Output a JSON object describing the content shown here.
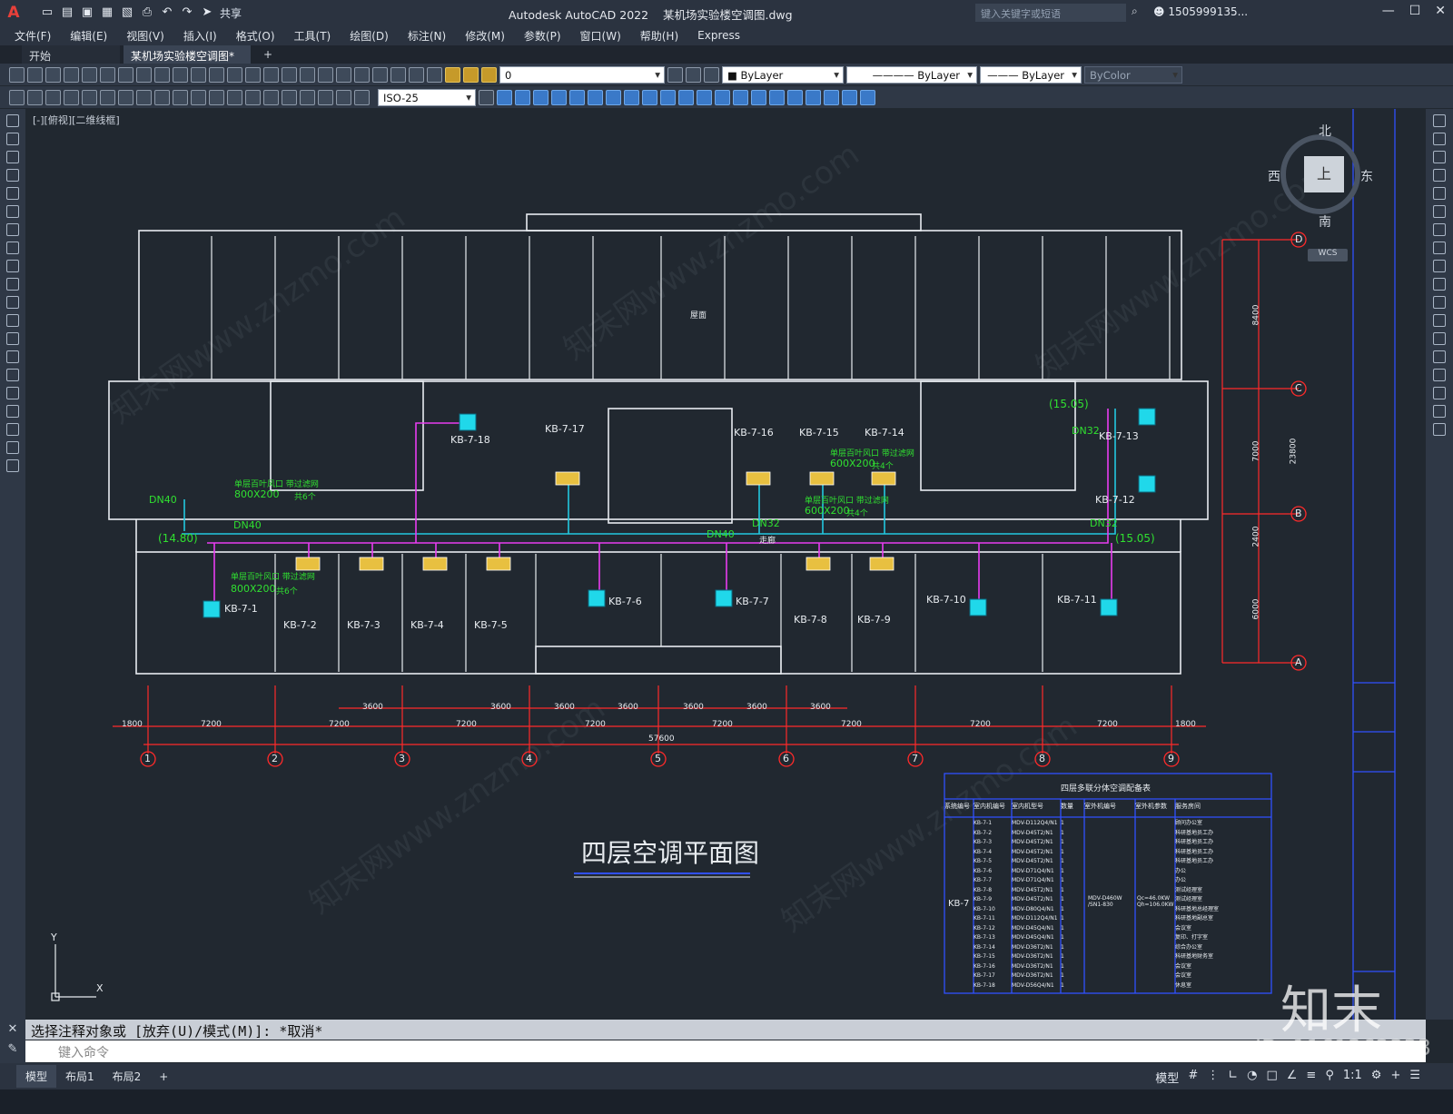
{
  "app": {
    "title": "Autodesk AutoCAD 2022",
    "document": "某机场实验楼空调图.dwg",
    "share": "共享",
    "search_placeholder": "键入关键字或短语",
    "user": "1505999135..."
  },
  "menu": [
    "文件(F)",
    "编辑(E)",
    "视图(V)",
    "插入(I)",
    "格式(O)",
    "工具(T)",
    "绘图(D)",
    "标注(N)",
    "修改(M)",
    "参数(P)",
    "窗口(W)",
    "帮助(H)",
    "Express"
  ],
  "tabs": [
    "开始",
    "某机场实验楼空调图*"
  ],
  "toolbar": {
    "layer": "0",
    "color": "ByLayer",
    "linetype": "ByLayer",
    "lineweight": "ByLayer",
    "plotstyle": "ByColor",
    "dimstyle": "ISO-25"
  },
  "view_label": "[-][俯视][二维线框]",
  "viewcube": {
    "north": "北",
    "south": "南",
    "east": "东",
    "west": "西",
    "top": "上",
    "wcs": "WCS"
  },
  "drawing": {
    "title": "四层空调平面图",
    "roof": "屋面",
    "grid_numbers": [
      "1",
      "2",
      "3",
      "4",
      "5",
      "6",
      "7",
      "8",
      "9"
    ],
    "grid_letters": [
      "D",
      "C",
      "B",
      "A"
    ],
    "dims_bottom": [
      "1800",
      "7200",
      "7200",
      "7200",
      "7200",
      "7200",
      "7200",
      "7200",
      "7200",
      "1800"
    ],
    "dims_sub": [
      "3600",
      "3600",
      "3600",
      "3600",
      "3600",
      "3600",
      "3600"
    ],
    "total": "57600",
    "dims_right": [
      "8400",
      "7000",
      "2400",
      "6000",
      "23800"
    ],
    "units_top": [
      "KB-7-18",
      "KB-7-17",
      "KB-7-16",
      "KB-7-15",
      "KB-7-14",
      "KB-7-13",
      "KB-7-12"
    ],
    "units_bottom": [
      "KB-7-1",
      "KB-7-2",
      "KB-7-3",
      "KB-7-4",
      "KB-7-5",
      "KB-7-6",
      "KB-7-7",
      "KB-7-8",
      "KB-7-9",
      "KB-7-10",
      "KB-7-11"
    ],
    "pipes": [
      "DN40",
      "DN40",
      "DN40",
      "DN32",
      "DN32",
      "DN32"
    ],
    "levels": [
      "(14.80)",
      "(15.05)",
      "(15.05)"
    ],
    "vents": [
      "单层百叶风口 带过滤网",
      "800X200",
      "共6个",
      "600X200",
      "共4个"
    ],
    "corridor": "走廊"
  },
  "table": {
    "title": "四层多联分体空调配备表",
    "headers": [
      "系统编号",
      "室内机编号",
      "室内机型号",
      "数量",
      "室外机编号",
      "室外机参数",
      "服务房间"
    ],
    "system": "KB-7",
    "outdoor_model": "MDV-D460W /SN1-830",
    "outdoor_params": "Qc=46.0KW Qh=106.0KW",
    "rows": [
      {
        "no": "KB-7-1",
        "model": "MDV-D112Q4/N1",
        "qty": "1",
        "room": "顾问办公室"
      },
      {
        "no": "KB-7-2",
        "model": "MDV-D45T2/N1",
        "qty": "1",
        "room": "科研基地员工办"
      },
      {
        "no": "KB-7-3",
        "model": "MDV-D45T2/N1",
        "qty": "1",
        "room": "科研基地员工办"
      },
      {
        "no": "KB-7-4",
        "model": "MDV-D45T2/N1",
        "qty": "1",
        "room": "科研基地员工办"
      },
      {
        "no": "KB-7-5",
        "model": "MDV-D45T2/N1",
        "qty": "1",
        "room": "科研基地员工办"
      },
      {
        "no": "KB-7-6",
        "model": "MDV-D71Q4/N1",
        "qty": "1",
        "room": "办公"
      },
      {
        "no": "KB-7-7",
        "model": "MDV-D71Q4/N1",
        "qty": "1",
        "room": "办公"
      },
      {
        "no": "KB-7-8",
        "model": "MDV-D45T2/N1",
        "qty": "1",
        "room": "测试经理室"
      },
      {
        "no": "KB-7-9",
        "model": "MDV-D45T2/N1",
        "qty": "1",
        "room": "测试经理室"
      },
      {
        "no": "KB-7-10",
        "model": "MDV-D80Q4/N1",
        "qty": "1",
        "room": "科研基地总经理室"
      },
      {
        "no": "KB-7-11",
        "model": "MDV-D112Q4/N1",
        "qty": "1",
        "room": "科研基地副总室"
      },
      {
        "no": "KB-7-12",
        "model": "MDV-D45Q4/N1",
        "qty": "1",
        "room": "会议室"
      },
      {
        "no": "KB-7-13",
        "model": "MDV-D45Q4/N1",
        "qty": "1",
        "room": "复印、打字室"
      },
      {
        "no": "KB-7-14",
        "model": "MDV-D36T2/N1",
        "qty": "1",
        "room": "综合办公室"
      },
      {
        "no": "KB-7-15",
        "model": "MDV-D36T2/N1",
        "qty": "1",
        "room": "科研基地财务室"
      },
      {
        "no": "KB-7-16",
        "model": "MDV-D36T2/N1",
        "qty": "1",
        "room": "会议室"
      },
      {
        "no": "KB-7-17",
        "model": "MDV-D36T2/N1",
        "qty": "1",
        "room": "会议室"
      },
      {
        "no": "KB-7-18",
        "model": "MDV-D56Q4/N1",
        "qty": "1",
        "room": "休息室"
      }
    ]
  },
  "command": {
    "history": "选择注释对象或 [放弃(U)/模式(M)]: *取消*",
    "placeholder": "键入命令"
  },
  "status": {
    "layouts": [
      "模型",
      "布局1",
      "布局2"
    ],
    "model": "模型",
    "scale": "1:1"
  },
  "watermark": {
    "site": "知末网www.znzmo.com",
    "logo": "知末",
    "id": "ID: 1161262333"
  },
  "colors": {
    "bg": "#212830",
    "wall": "#e8ecf0",
    "pipe_cyan": "#22c8e0",
    "pipe_magenta": "#e83cf0",
    "dim_red": "#ff2a2a",
    "text_green": "#30e030",
    "table_blue": "#3050ff"
  }
}
